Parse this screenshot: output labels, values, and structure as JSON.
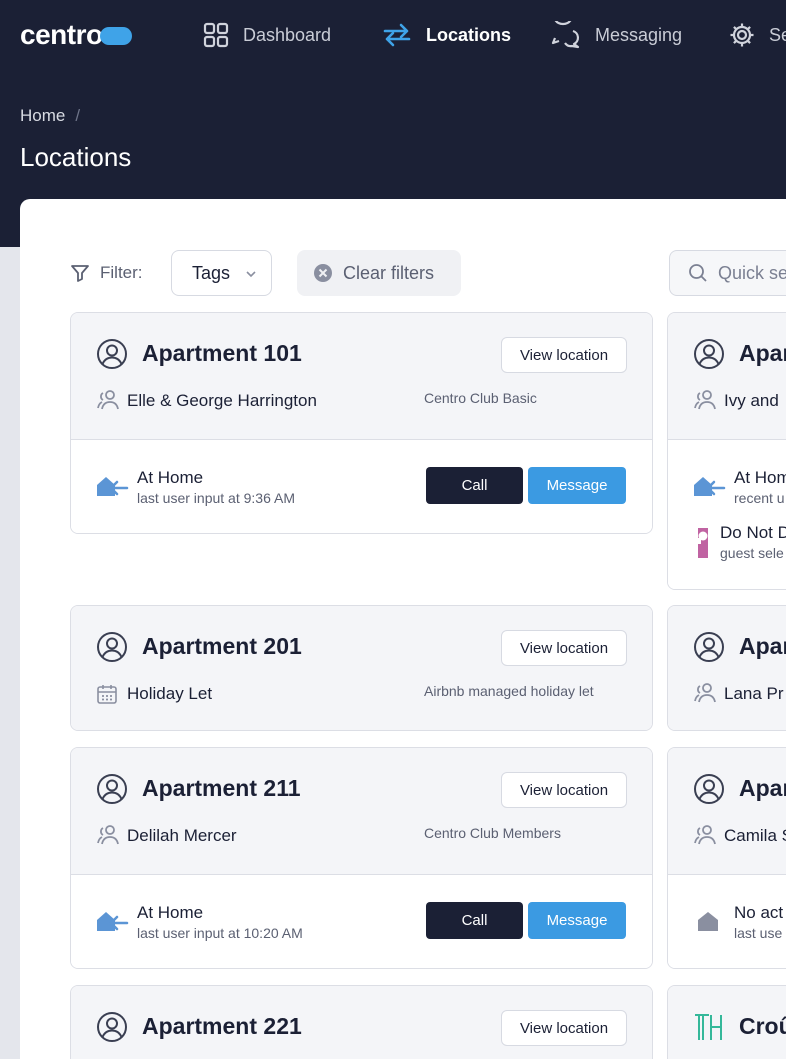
{
  "brand": {
    "name": "centro",
    "accent": "#3fa3e8"
  },
  "nav": [
    {
      "label": "Dashboard",
      "icon": "grid-icon"
    },
    {
      "label": "Locations",
      "icon": "swap-arrows-icon",
      "active": true
    },
    {
      "label": "Messaging",
      "icon": "chat-bubbles-icon"
    },
    {
      "label": "Se",
      "icon": "gear-icon"
    }
  ],
  "breadcrumb": {
    "home": "Home",
    "separator": "/"
  },
  "page_title": "Locations",
  "filters": {
    "label": "Filter:",
    "tags": "Tags",
    "clear": "Clear filters",
    "search_placeholder": "Quick se"
  },
  "cards_left": [
    {
      "title": "Apartment 101",
      "person": "Elle & George Harrington",
      "plan": "Centro Club Basic",
      "view": "View location",
      "status": "At Home",
      "sub": "last user input at 9:36 AM",
      "call": "Call",
      "message": "Message"
    },
    {
      "title": "Apartment 201",
      "person": "Holiday Let",
      "plan": "Airbnb managed holiday let",
      "view": "View location"
    },
    {
      "title": "Apartment 211",
      "person": "Delilah Mercer",
      "plan": "Centro Club Members",
      "view": "View location",
      "status": "At Home",
      "sub": "last user input at 10:20 AM",
      "call": "Call",
      "message": "Message"
    },
    {
      "title": "Apartment 221",
      "view": "View location"
    }
  ],
  "cards_right": [
    {
      "title": "Apar",
      "person": "Ivy and",
      "status1": "At Hom",
      "sub1": "recent u",
      "status2": "Do Not D",
      "sub2": "guest sele"
    },
    {
      "title": "Apar",
      "person": "Lana Pr"
    },
    {
      "title": "Apar",
      "person": "Camila S",
      "status1": "No act",
      "sub1": "last use"
    },
    {
      "title": "Croû"
    }
  ]
}
